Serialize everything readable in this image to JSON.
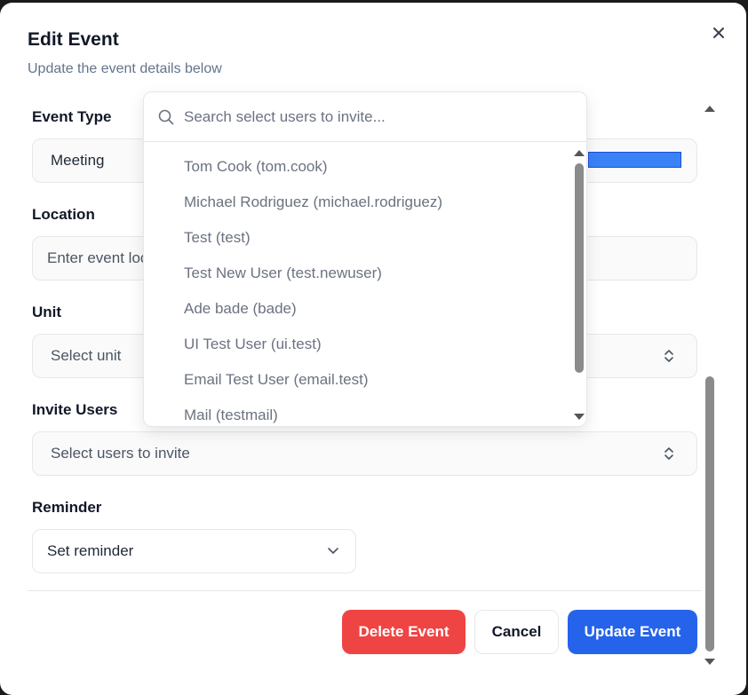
{
  "dialog": {
    "title": "Edit Event",
    "subtitle": "Update the event details below"
  },
  "form": {
    "event_type": {
      "label": "Event Type",
      "value": "Meeting"
    },
    "location": {
      "label": "Location",
      "placeholder": "Enter event location"
    },
    "unit": {
      "label": "Unit",
      "placeholder": "Select unit"
    },
    "invite_users": {
      "label": "Invite Users",
      "placeholder": "Select users to invite"
    },
    "reminder": {
      "label": "Reminder",
      "value": "Set reminder"
    }
  },
  "dropdown": {
    "search_placeholder": "Search select users to invite...",
    "items": [
      "Tom Cook (tom.cook)",
      "Michael Rodriguez (michael.rodriguez)",
      "Test (test)",
      "Test New User (test.newuser)",
      "Ade bade (bade)",
      "UI Test User (ui.test)",
      "Email Test User (email.test)",
      "Mail (testmail)"
    ]
  },
  "actions": {
    "delete": "Delete Event",
    "cancel": "Cancel",
    "update": "Update Event"
  },
  "colors": {
    "delete": "#ef4444",
    "update": "#2563eb",
    "accent_bar": "#3b82f6"
  },
  "icons": [
    "close-icon",
    "search-icon",
    "chevron-updown-icon",
    "chevron-down-icon"
  ]
}
